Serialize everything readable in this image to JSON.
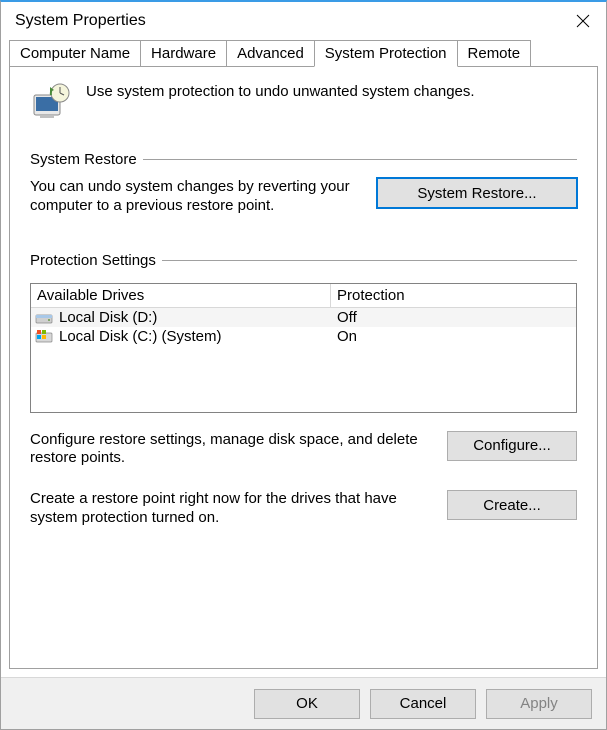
{
  "window": {
    "title": "System Properties"
  },
  "tabs": {
    "computer_name": "Computer Name",
    "hardware": "Hardware",
    "advanced": "Advanced",
    "system_protection": "System Protection",
    "remote": "Remote"
  },
  "intro": {
    "text": "Use system protection to undo unwanted system changes."
  },
  "restore": {
    "group_label": "System Restore",
    "text": "You can undo system changes by reverting your computer to a previous restore point.",
    "button": "System Restore..."
  },
  "protection": {
    "group_label": "Protection Settings",
    "header_drive": "Available Drives",
    "header_prot": "Protection",
    "drives": [
      {
        "name": "Local Disk (D:)",
        "protection": "Off"
      },
      {
        "name": "Local Disk (C:) (System)",
        "protection": "On"
      }
    ],
    "configure_text": "Configure restore settings, manage disk space, and delete restore points.",
    "configure_button": "Configure...",
    "create_text": "Create a restore point right now for the drives that have system protection turned on.",
    "create_button": "Create..."
  },
  "footer": {
    "ok": "OK",
    "cancel": "Cancel",
    "apply": "Apply"
  }
}
